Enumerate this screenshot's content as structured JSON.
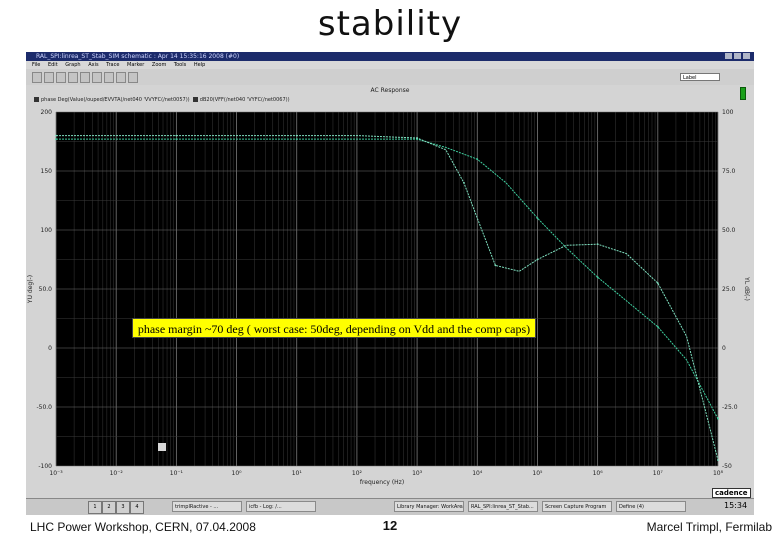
{
  "slide": {
    "title": "stability",
    "footer_left": "LHC Power Workshop, CERN, 07.04.2008",
    "page_number": "12",
    "footer_right": "Marcel Trimpl, Fermilab"
  },
  "window": {
    "title": "RAL_SPI:linrea_ST_Stab_SIM schematic : Apr 14 15:35:16 2008 (#0)",
    "menu": [
      "File",
      "Edit",
      "Graph",
      "Axis",
      "Trace",
      "Marker",
      "Zoom",
      "Tools",
      "Help"
    ],
    "toolbar_field": "Label"
  },
  "chart_data": {
    "type": "line",
    "title": "AC Response",
    "xlabel": "frequency (Hz)",
    "ylabel_left": "YU deg(-)",
    "ylabel_right": "YL dB(-)",
    "x_scale": "log",
    "x_ticks": [
      "10⁻³",
      "10⁻²",
      "10⁻¹",
      "10⁰",
      "10¹",
      "10²",
      "10³",
      "10⁴",
      "10⁵",
      "10⁶",
      "10⁷",
      "10⁸"
    ],
    "y_left_ticks": [
      "200",
      "150",
      "100",
      "50.0",
      "0",
      "-50.0",
      "-100"
    ],
    "y_right_ticks": [
      "100",
      "75.0",
      "50.0",
      "25.0",
      "0",
      "-25.0",
      "-50"
    ],
    "ylim_left": [
      -100,
      200
    ],
    "ylim_right": [
      -50,
      100
    ],
    "grid": true,
    "legend": [
      "phase Deg(Value(/ouped/EVVTA(/net040 'VVYFC(/net0057))",
      "dB20(VFF(/net040 'VYFC(/net0067))"
    ],
    "series": [
      {
        "axis": "left",
        "color": "#3fd0a0",
        "x": [
          0.001,
          0.01,
          0.1,
          1,
          10,
          100,
          1000,
          3000,
          10000,
          30000,
          100000,
          300000,
          1000000,
          3000000,
          10000000,
          30000000,
          100000000
        ],
        "y": [
          177,
          177,
          177,
          177,
          177,
          177,
          177,
          170,
          160,
          140,
          110,
          85,
          60,
          40,
          18,
          -10,
          -60
        ]
      },
      {
        "axis": "left",
        "color": "#7fe0c0",
        "x": [
          0.001,
          0.01,
          0.1,
          1,
          10,
          100,
          1000,
          3000,
          6000,
          10000,
          20000,
          50000,
          100000,
          300000,
          1000000,
          3000000,
          10000000,
          30000000,
          100000000
        ],
        "y": [
          180,
          180,
          180,
          180,
          180,
          180,
          178,
          168,
          140,
          110,
          70,
          65,
          75,
          87,
          88,
          80,
          55,
          10,
          -95
        ]
      }
    ]
  },
  "annotation": "phase margin ~70 deg ( worst case: 50deg, depending on Vdd and the comp caps)",
  "taskbar": {
    "workspaces": [
      "1",
      "2",
      "3",
      "4"
    ],
    "tasks": [
      "trimplRactive - ...",
      "icfb - Log: /...",
      "Library Manager: WorkArea",
      "RAL_SPI:linrea_ST_Stab...",
      "Screen Capture Program",
      "Define (4)"
    ],
    "brand": "cadence",
    "clock": "15:34"
  }
}
